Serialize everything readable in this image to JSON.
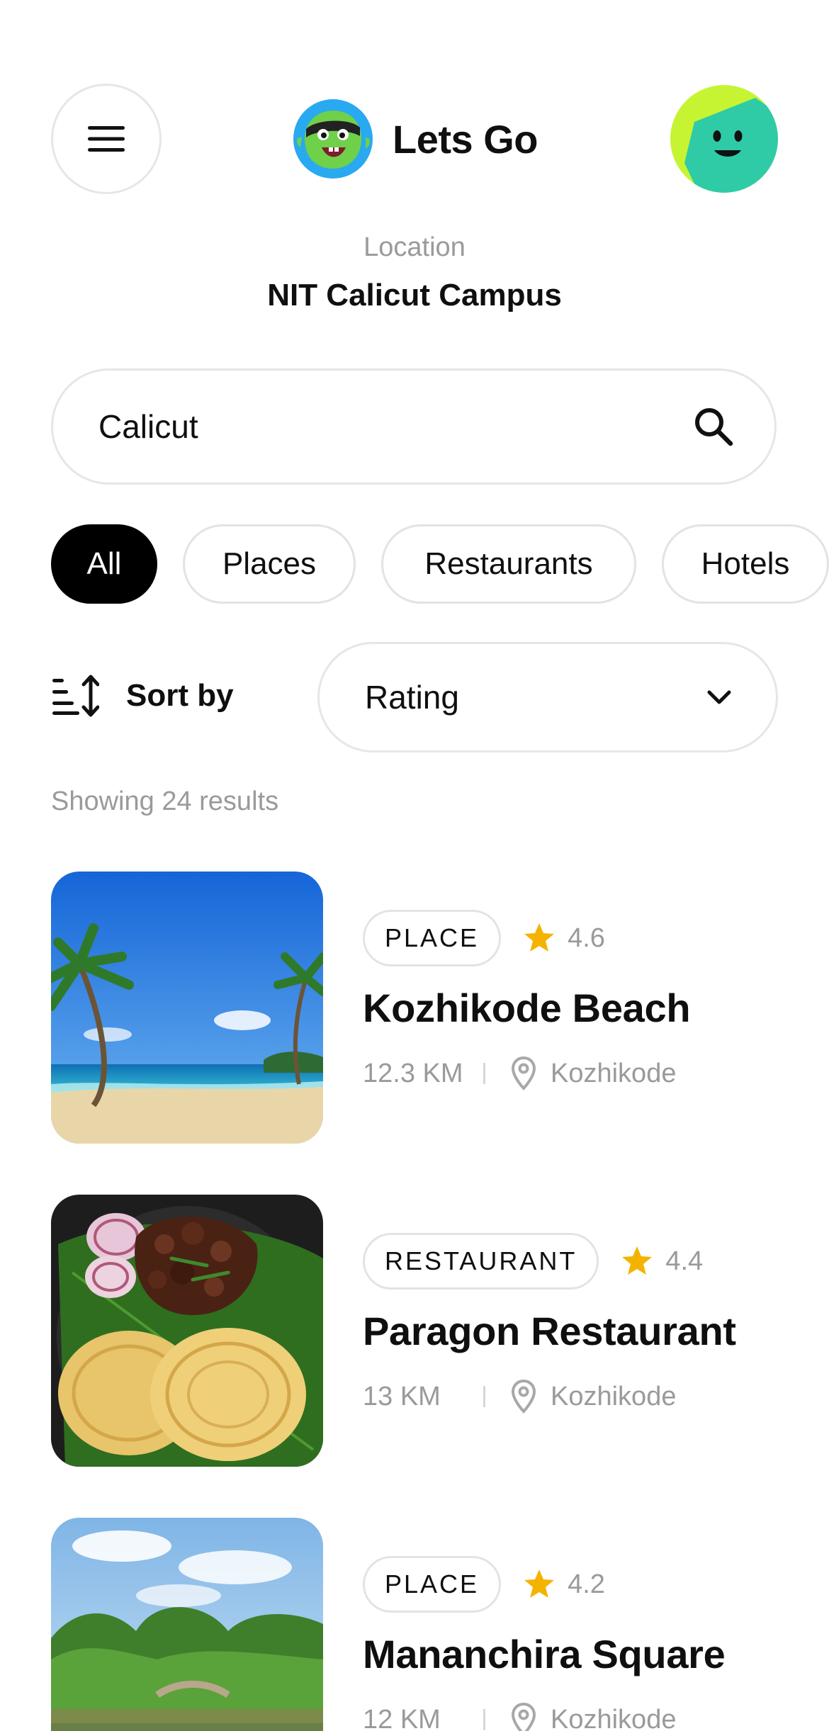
{
  "app": {
    "title": "Lets Go"
  },
  "icons": {
    "menu": "hamburger-menu-icon",
    "logo": "mascot-logo-icon",
    "avatar": "smiley-avatar",
    "search": "search-icon",
    "sort": "sort-icon",
    "dropdown": "chevron-down-icon",
    "rating": "star-icon",
    "location": "map-pin-icon"
  },
  "colors": {
    "accent_black": "#000000",
    "star": "#F5B301",
    "muted_text": "#9A9A9A",
    "border": "#E6E6E6",
    "avatar_lime": "#C6F432",
    "avatar_teal": "#2FCBA7"
  },
  "location": {
    "label": "Location",
    "name": "NIT Calicut Campus"
  },
  "search": {
    "value": "Calicut",
    "placeholder": ""
  },
  "filters": [
    {
      "label": "All",
      "active": true
    },
    {
      "label": "Places",
      "active": false
    },
    {
      "label": "Restaurants",
      "active": false
    },
    {
      "label": "Hotels",
      "active": false
    }
  ],
  "sort": {
    "label": "Sort by",
    "selected": "Rating"
  },
  "results": {
    "count_text": "Showing 24 results",
    "items": [
      {
        "type": "PLACE",
        "rating": "4.6",
        "title": "Kozhikode Beach",
        "distance": "12.3 KM",
        "city": "Kozhikode",
        "image": "beach-palm-trees"
      },
      {
        "type": "RESTAURANT",
        "rating": "4.4",
        "title": "Paragon Restaurant",
        "distance": "13 KM",
        "city": "Kozhikode",
        "image": "parotta-beef-fry"
      },
      {
        "type": "PLACE",
        "rating": "4.2",
        "title": "Mananchira Square",
        "distance": "12 KM",
        "city": "Kozhikode",
        "image": "park-lake-trees"
      }
    ]
  }
}
